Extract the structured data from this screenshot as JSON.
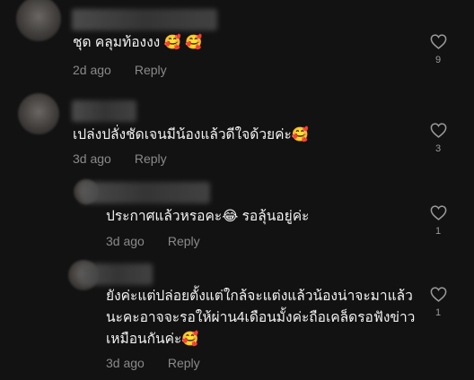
{
  "comments": [
    {
      "text": "ชุด คลุมท้องงง 🥰 🥰",
      "time": "2d ago",
      "reply_label": "Reply",
      "likes": "9"
    },
    {
      "text": "เปล่งปลั่งชัดเจนมีน้องแล้วดีใจด้วยค่ะ🥰",
      "time": "3d ago",
      "reply_label": "Reply",
      "likes": "3"
    },
    {
      "text": "ประกาศแล้วหรอคะ😂  รอลุ้นอยู่ค่ะ",
      "time": "3d ago",
      "reply_label": "Reply",
      "likes": "1"
    },
    {
      "text": "ยังค่ะแต่ปล่อยตั้งแต่ใกล้จะแต่งแล้วน้องน่าจะมาแล้ว\nนะคะอาจจะรอให้ผ่าน4เดือนมั้งค่ะถือเคล็ดรอฟังข่าว\nเหมือนกันค่ะ🥰",
      "time": "3d ago",
      "reply_label": "Reply",
      "likes": "1"
    }
  ],
  "icons": {
    "like": "heart-outline-icon"
  },
  "colors": {
    "background": "#121212",
    "text": "#f2f2f2",
    "meta": "#8a8a8a"
  }
}
